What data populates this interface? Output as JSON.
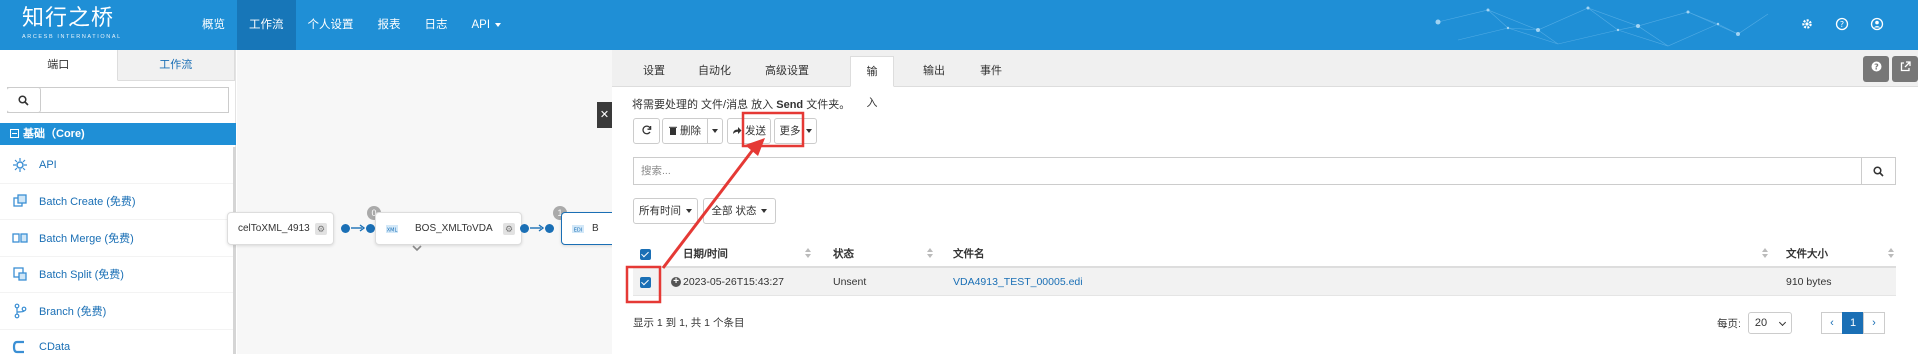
{
  "header": {
    "logo_name": "知行之桥",
    "logo_sub": "ARCESB INTERNATIONAL",
    "nav": [
      {
        "label": "概览"
      },
      {
        "label": "工作流",
        "active": true
      },
      {
        "label": "个人设置"
      },
      {
        "label": "报表"
      },
      {
        "label": "日志"
      },
      {
        "label": "API",
        "dropdown": true
      }
    ],
    "icons": [
      "gear-icon",
      "help-icon",
      "user-icon"
    ],
    "brand_color": "#1f8fd6"
  },
  "left_panel": {
    "tabs": [
      "端口",
      "工作流"
    ],
    "active_tab": "端口",
    "search_placeholder": "搜索",
    "category": "基础（Core)",
    "connectors": [
      {
        "label": "API",
        "icon": "api-icon"
      },
      {
        "label": "Batch Create (免费)",
        "icon": "batch-create-icon"
      },
      {
        "label": "Batch Merge (免费)",
        "icon": "batch-merge-icon"
      },
      {
        "label": "Batch Split (免费)",
        "icon": "batch-split-icon"
      },
      {
        "label": "Branch (免费)",
        "icon": "branch-icon"
      },
      {
        "label": "CData",
        "icon": "cdata-icon"
      }
    ]
  },
  "canvas": {
    "nodes": [
      {
        "label": "celToXML_4913"
      },
      {
        "label": "BOS_XMLToVDA",
        "badge": "0"
      },
      {
        "label": "B",
        "badge": "1"
      }
    ]
  },
  "right_panel": {
    "tabs": [
      "设置",
      "自动化",
      "高级设置",
      "输入",
      "输出",
      "事件"
    ],
    "active_tab": "输入",
    "hint_prefix": "将需要处理的 文件/消息 放入",
    "hint_folder": "Send",
    "hint_suffix": "文件夹。",
    "toolbar": {
      "delete_label": "删除",
      "send_label": "发送",
      "more_label": "更多"
    },
    "search_placeholder": "搜索...",
    "filters": {
      "time": "所有时间",
      "status": "全部 状态"
    },
    "table": {
      "columns": [
        "日期/时间",
        "状态",
        "文件名",
        "文件大小"
      ],
      "rows": [
        {
          "datetime": "2023-05-26T15:43:27",
          "status": "Unsent",
          "filename": "VDA4913_TEST_00005.edi",
          "size": "910 bytes",
          "checked": true
        }
      ]
    },
    "footer_info": "显示 1 到 1, 共 1 个条目",
    "per_page_label": "每页:",
    "per_page_value": "20",
    "pager": {
      "prev": "‹",
      "current": "1",
      "next": "›"
    }
  },
  "annotation_color": "#e53935"
}
